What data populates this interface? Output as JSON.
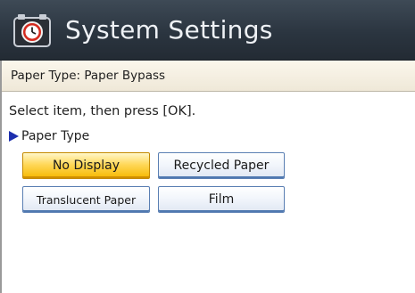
{
  "window": {
    "title": "System Settings",
    "icon": "settings-clock-icon"
  },
  "subheader": {
    "text": "Paper Type: Paper Bypass"
  },
  "main": {
    "instruction": "Select item, then press [OK].",
    "section_label": "Paper Type",
    "options": [
      {
        "label": "No Display",
        "selected": true
      },
      {
        "label": "Recycled Paper",
        "selected": false
      },
      {
        "label": "Translucent Paper",
        "selected": false
      },
      {
        "label": "Film",
        "selected": false
      }
    ]
  },
  "colors": {
    "titlebar": "#2b3540",
    "selected": "#ffd85a",
    "button_border": "#5a7fb3",
    "section_marker": "#1d2fae"
  }
}
